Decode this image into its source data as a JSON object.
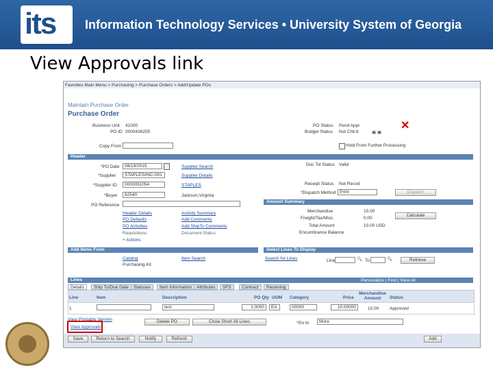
{
  "banner": {
    "logo": "its",
    "title": "Information Technology Services • University System of Georgia"
  },
  "slide": {
    "title": "View Approvals link"
  },
  "app": {
    "breadcrumb": "Favorites  Main Menu  >  Purchasing  >  Purchase Orders  >  Add/Update POs",
    "crumb_parts": [
      "avorites",
      "Main Menu",
      "Purchasing",
      "Purchase Orders",
      "Add/Update POs"
    ],
    "page_subtitle": "Maintain Purchase Order",
    "page_title": "Purchase Order",
    "business_unit_label": "Business Unit",
    "business_unit": "41000",
    "po_id_label": "PO ID",
    "po_id": "0000436255",
    "copy_from_label": "Copy From",
    "po_status_label": "PO Status",
    "po_status": "Pend Appr",
    "budget_status_label": "Budget Status",
    "budget_status": "Not Chk'd",
    "hold_label": "Hold From Further Processing",
    "header_label": "Header",
    "po_date_label": "*PO Date",
    "po_date": "08/19/2015",
    "supplier_label": "*Supplier",
    "supplier": "STAPLES/INC-001",
    "supplier_id_label": "*Supplier ID",
    "supplier_id": "0000051054",
    "buyer_label": "*Buyer",
    "buyer": "82540",
    "po_reference_label": "PO Reference",
    "supplier_search": "Supplier Search",
    "supplier_details": "Supplier Details",
    "staples": "STAPLES",
    "buyer_name": "Jackson,Virginia",
    "doc_tol_label": "Doc Tol Status",
    "doc_tol": "Valid",
    "receipt_status_label": "Receipt Status",
    "receipt_status": "Not Recvd",
    "dispatch_method_label": "*Dispatch Method",
    "dispatch_method": "Print",
    "dispatch_btn": "Dispatch",
    "header_links": [
      "Header Details",
      "PO Defaults",
      "PO Activities",
      "Requisitions",
      "+ Actions"
    ],
    "activity_links": [
      "Activity Summary",
      "Add Comments",
      "Add ShipTo Comments",
      "Document Status"
    ],
    "amount_summary_label": "Amount Summary",
    "merch_label": "Merchandise",
    "merch": "10.00",
    "freight_label": "Freight/Tax/Misc.",
    "freight": "0.00",
    "total_label": "Total Amount",
    "total": "10.00  USD",
    "encumbrance_label": "Encumbrance Balance",
    "calculate_btn": "Calculate",
    "add_items_label": "Add Items From",
    "catalog": "Catalog",
    "purchasing_kit": "Purchasing Kit",
    "item_search": "Item Search",
    "select_lines_label": "Select Lines To Display",
    "search_all_lines": "Search for Lines",
    "line_label": "Line",
    "to_label": "To",
    "retrieve_btn": "Retrieve",
    "lines_label": "Lines",
    "lines_nav": "Personalize | Find | View All",
    "tabs": [
      "Details",
      "Ship To/Due Date",
      "Statuses",
      "Item Information",
      "Attributes",
      "SFS",
      "Contract",
      "Receiving"
    ],
    "col_headers": [
      "Line",
      "Item",
      "Description",
      "PO Qty",
      "UOM",
      "Category",
      "Price",
      "Merchandise Amount",
      "Status"
    ],
    "row": {
      "line": "1",
      "description": "test",
      "qty": "1.0000",
      "uom": "EA",
      "category": "00000",
      "price": "10.00000",
      "amount": "10.00",
      "status": "Approved"
    },
    "view_printable": "View Printable Version",
    "view_approvals": "View Approvals",
    "delete_po_btn": "Delete PO",
    "close_short_btn": "Close Short All Lines",
    "goto_label": "*Go to",
    "goto_value": "More",
    "bottom_buttons": [
      "Save",
      "Return to Search",
      "Notify",
      "Refresh"
    ],
    "add_btn": "Add"
  },
  "colors": {
    "banner": "#1f4f8c",
    "section_header": "#5b84b5",
    "link": "#1b4a9e",
    "highlight": "#cc0000"
  }
}
